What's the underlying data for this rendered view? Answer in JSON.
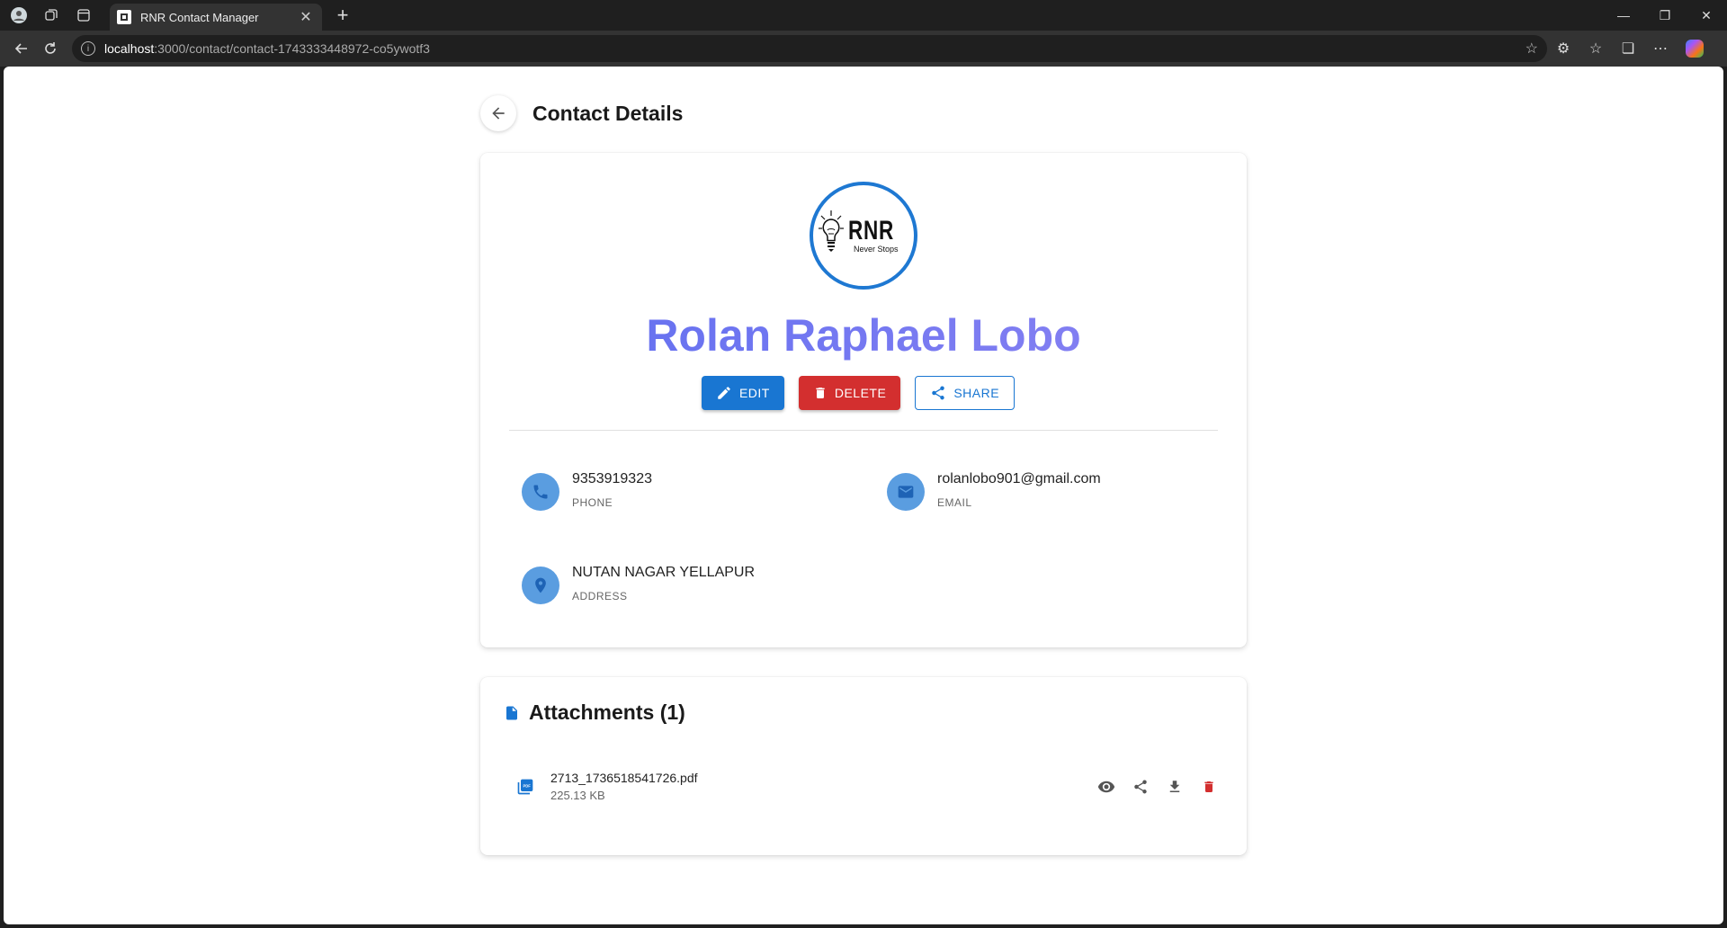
{
  "browser": {
    "tab_title": "RNR Contact Manager",
    "url_host": "localhost",
    "url_path": ":3000/contact/contact-1743333448972-co5ywotf3"
  },
  "page": {
    "title": "Contact Details"
  },
  "contact": {
    "logo_text": "RNR",
    "logo_tagline": "Never Stops",
    "name": "Rolan Raphael Lobo",
    "phone": "9353919323",
    "phone_label": "PHONE",
    "email": "rolanlobo901@gmail.com",
    "email_label": "EMAIL",
    "address": "NUTAN NAGAR YELLAPUR",
    "address_label": "ADDRESS"
  },
  "actions": {
    "edit_label": "EDIT",
    "delete_label": "DELETE",
    "share_label": "SHARE"
  },
  "attachments": {
    "title": "Attachments (1)",
    "files": [
      {
        "name": "2713_1736518541726.pdf",
        "size": "225.13 KB"
      }
    ]
  },
  "colors": {
    "primary": "#1976d2",
    "danger": "#d32f2f",
    "name_gradient_start": "#5f6ef0",
    "icon_circle": "#5a9de0"
  }
}
